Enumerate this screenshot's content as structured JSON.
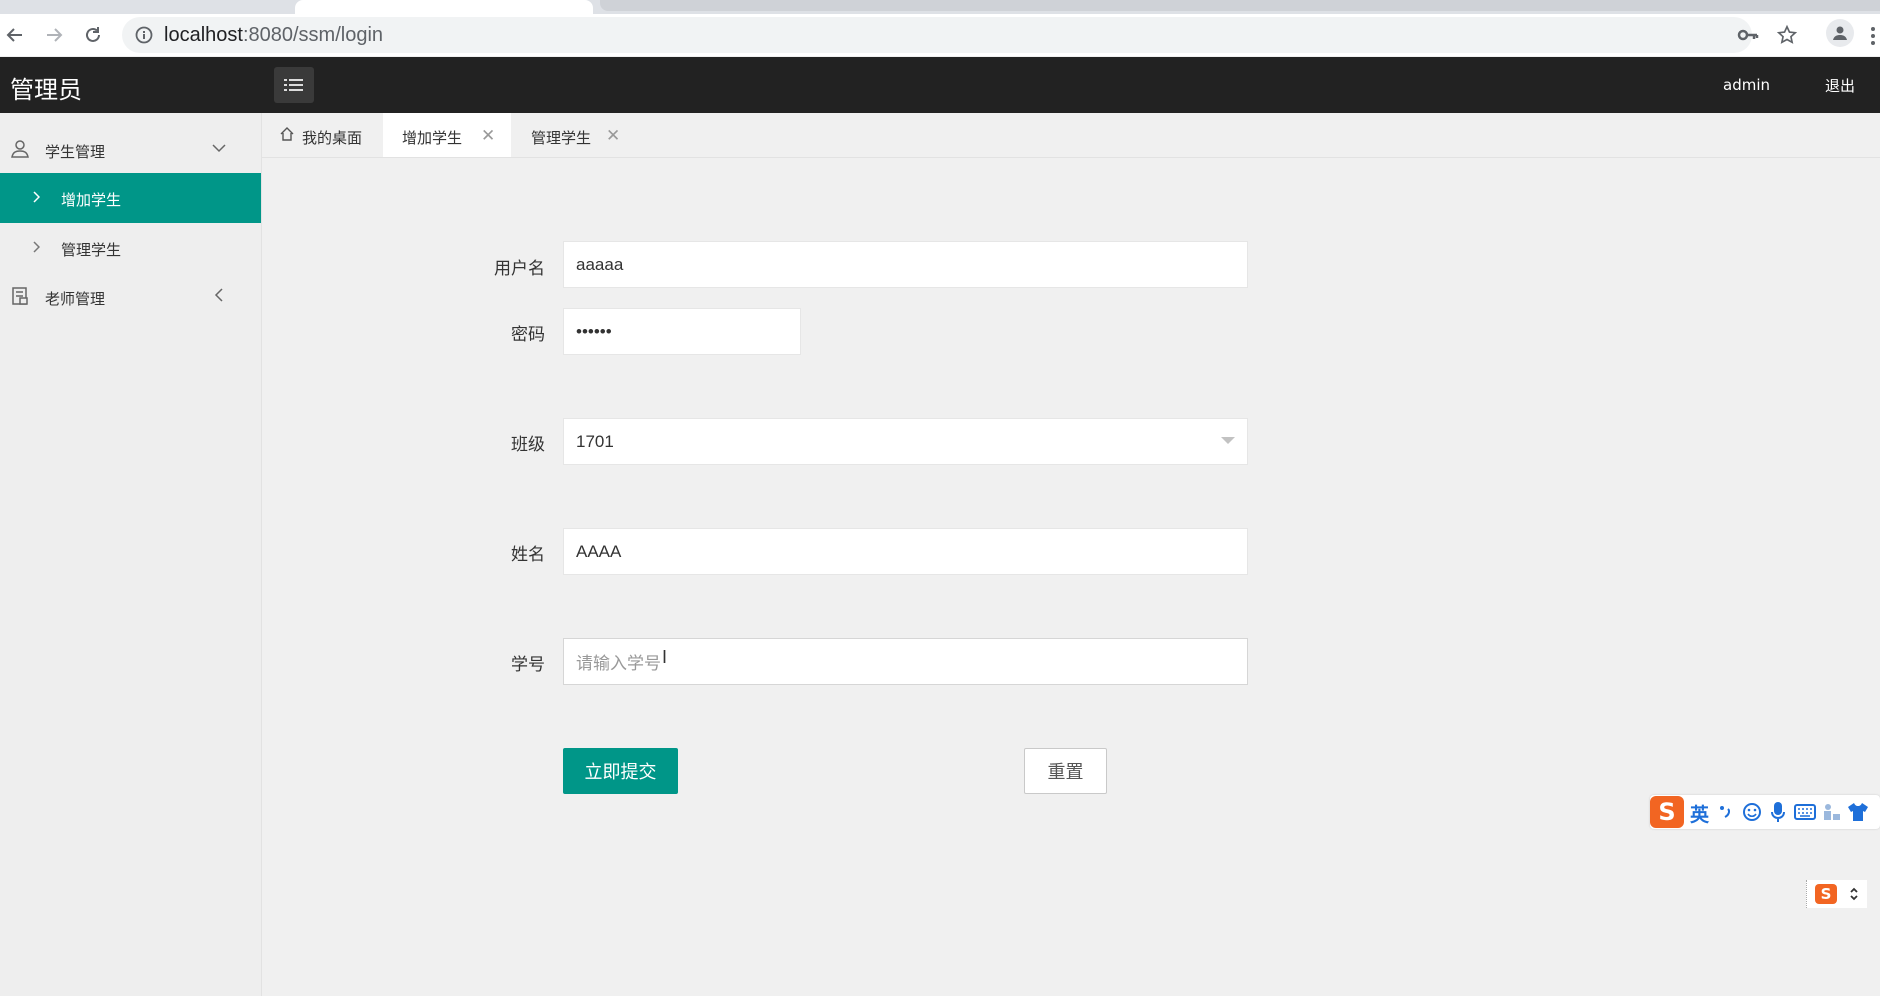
{
  "browser": {
    "url_host": "localhost",
    "url_rest": ":8080/ssm/login"
  },
  "header": {
    "title": "管理员",
    "user": "admin",
    "logout": "退出"
  },
  "sidebar": {
    "groups": [
      {
        "label": "学生管理",
        "items": [
          "增加学生",
          "管理学生"
        ]
      },
      {
        "label": "老师管理"
      }
    ],
    "active_item": "增加学生"
  },
  "tabs": [
    {
      "label": "我的桌面",
      "closable": false
    },
    {
      "label": "增加学生",
      "closable": true,
      "active": true
    },
    {
      "label": "管理学生",
      "closable": true
    }
  ],
  "form": {
    "username_label": "用户名",
    "username_value": "aaaaa",
    "password_label": "密码",
    "password_value": "••••••",
    "class_label": "班级",
    "class_value": "1701",
    "name_label": "姓名",
    "name_value": "AAAA",
    "student_no_label": "学号",
    "student_no_placeholder": "请输入学号",
    "submit_label": "立即提交",
    "reset_label": "重置"
  },
  "ime": {
    "lang": "英",
    "accent": "#f26522",
    "icon_color": "#1e6fd9"
  },
  "colors": {
    "primary": "#009688",
    "header_bg": "#222222"
  }
}
